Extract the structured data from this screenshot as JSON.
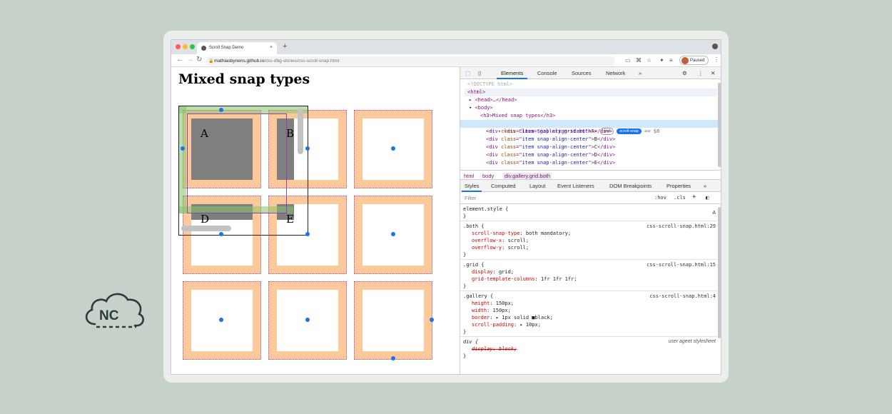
{
  "browser": {
    "tab_title": "Scroll Snap Demo",
    "tab_close": "×",
    "new_tab": "+",
    "url_host": "mathiasbynens.github.io",
    "url_path": "/css-dbg-stories/css-scroll-snap.html",
    "profile_label": "Paused",
    "traffic_lights": [
      "#ff5f57",
      "#febc2e",
      "#28c840"
    ]
  },
  "page": {
    "heading": "Mixed snap types",
    "grid_letters": [
      "A",
      "B",
      "D",
      "E"
    ],
    "accent_orange": "#fcc99a",
    "snap_dot_color": "#1a73e8"
  },
  "devtools": {
    "tabs": [
      "Elements",
      "Console",
      "Sources",
      "Network"
    ],
    "more": "»",
    "dom": {
      "doctype": "<!DOCTYPE html>",
      "html_open": "<html>",
      "head": "<head>…</head>",
      "body_open": "<body>",
      "h3": "<h3>Mixed snap types</h3>",
      "gallery_div": "<div class=\"gallery grid both\">",
      "badge_grid": "grid",
      "badge_snap": "scroll-snap",
      "selected_marker": "== $0",
      "items": [
        {
          "cls": "item snap-align-start",
          "text": "A"
        },
        {
          "cls": "item snap-align-center",
          "text": "B"
        },
        {
          "cls": "item snap-align-center",
          "text": "C"
        },
        {
          "cls": "item snap-align-center",
          "text": "D"
        },
        {
          "cls": "item snap-align-center",
          "text": "E"
        }
      ]
    },
    "breadcrumbs": [
      "html",
      "body",
      "div.gallery.grid.both"
    ],
    "subtabs": [
      "Styles",
      "Computed",
      "Layout",
      "Event Listeners",
      "DOM Breakpoints",
      "Properties"
    ],
    "filter_placeholder": "Filter",
    "hov": ":hov",
    "cls": ".cls",
    "rules": {
      "element_style": "element.style {",
      "both_selector": ".both {",
      "both_src": "css-scroll-snap.html:29",
      "both_props": [
        {
          "name": "scroll-snap-type",
          "value": "both mandatory;"
        },
        {
          "name": "overflow-x",
          "value": "scroll;"
        },
        {
          "name": "overflow-y",
          "value": "scroll;"
        }
      ],
      "grid_selector": ".grid {",
      "grid_src": "css-scroll-snap.html:15",
      "grid_props": [
        {
          "name": "display",
          "value": "grid;"
        },
        {
          "name": "grid-template-columns",
          "value": "1fr 1fr 1fr;"
        }
      ],
      "gallery_selector": ".gallery {",
      "gallery_src": "css-scroll-snap.html:4",
      "gallery_props": [
        {
          "name": "height",
          "value": "150px;"
        },
        {
          "name": "width",
          "value": "150px;"
        },
        {
          "name": "border",
          "value": "1px solid ■black;"
        },
        {
          "name": "scroll-padding",
          "value": "10px;"
        }
      ],
      "div_selector": "div {",
      "div_src": "user agent stylesheet",
      "div_prop": "display: block;",
      "close_brace": "}"
    }
  }
}
